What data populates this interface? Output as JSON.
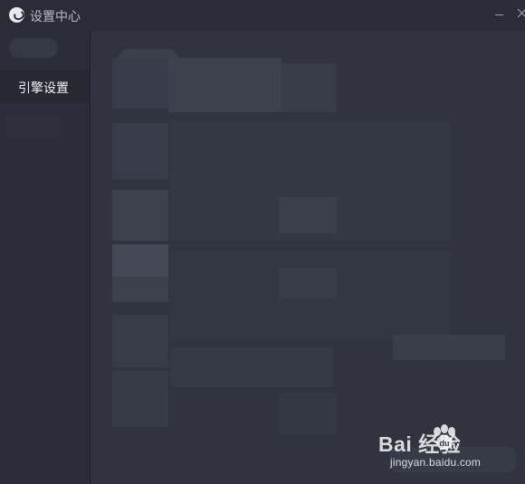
{
  "window": {
    "title": "设置中心",
    "minimize_label": "",
    "close_label": ""
  },
  "sidebar": {
    "items": [
      {
        "label": "引擎设置"
      }
    ]
  },
  "watermark": {
    "brand_text": "Bai 经验",
    "url": "jingyan.baidu.com"
  },
  "colors": {
    "titlebar": "#2a2d37",
    "sidebar": "#2b2e39",
    "selected_item": "#262832",
    "main_background": "#31343f",
    "text": "#f2f2f4"
  },
  "icons": {
    "app": "app-logo-icon",
    "minimize": "minimize-icon",
    "close": "close-icon",
    "watermark_paw": "paw-icon"
  }
}
